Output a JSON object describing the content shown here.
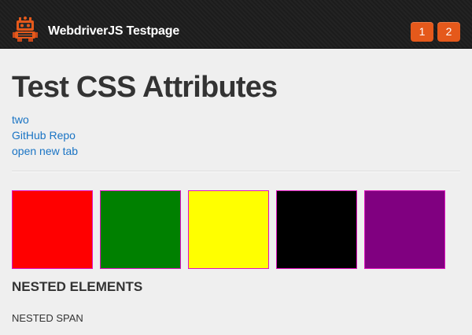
{
  "navbar": {
    "brand": "WebdriverJS Testpage",
    "buttons": [
      "1",
      "2"
    ],
    "logo_icon": "robot-logo-icon"
  },
  "main": {
    "title": "Test CSS Attributes",
    "links": [
      "two",
      "GitHub Repo",
      "open new tab"
    ],
    "color_boxes": [
      {
        "color": "#ff0000"
      },
      {
        "color": "#008000"
      },
      {
        "color": "#ffff00"
      },
      {
        "color": "#000000"
      },
      {
        "color": "#800080"
      }
    ],
    "box_border_color": "#e012c0",
    "nested_heading": "NESTED ELEMENTS",
    "nested_span": "NESTED SPAN"
  },
  "colors": {
    "navbar_bg": "#1e1e1e",
    "accent": "#e5591b",
    "link": "#1a74c4",
    "page_bg": "#efefef"
  }
}
